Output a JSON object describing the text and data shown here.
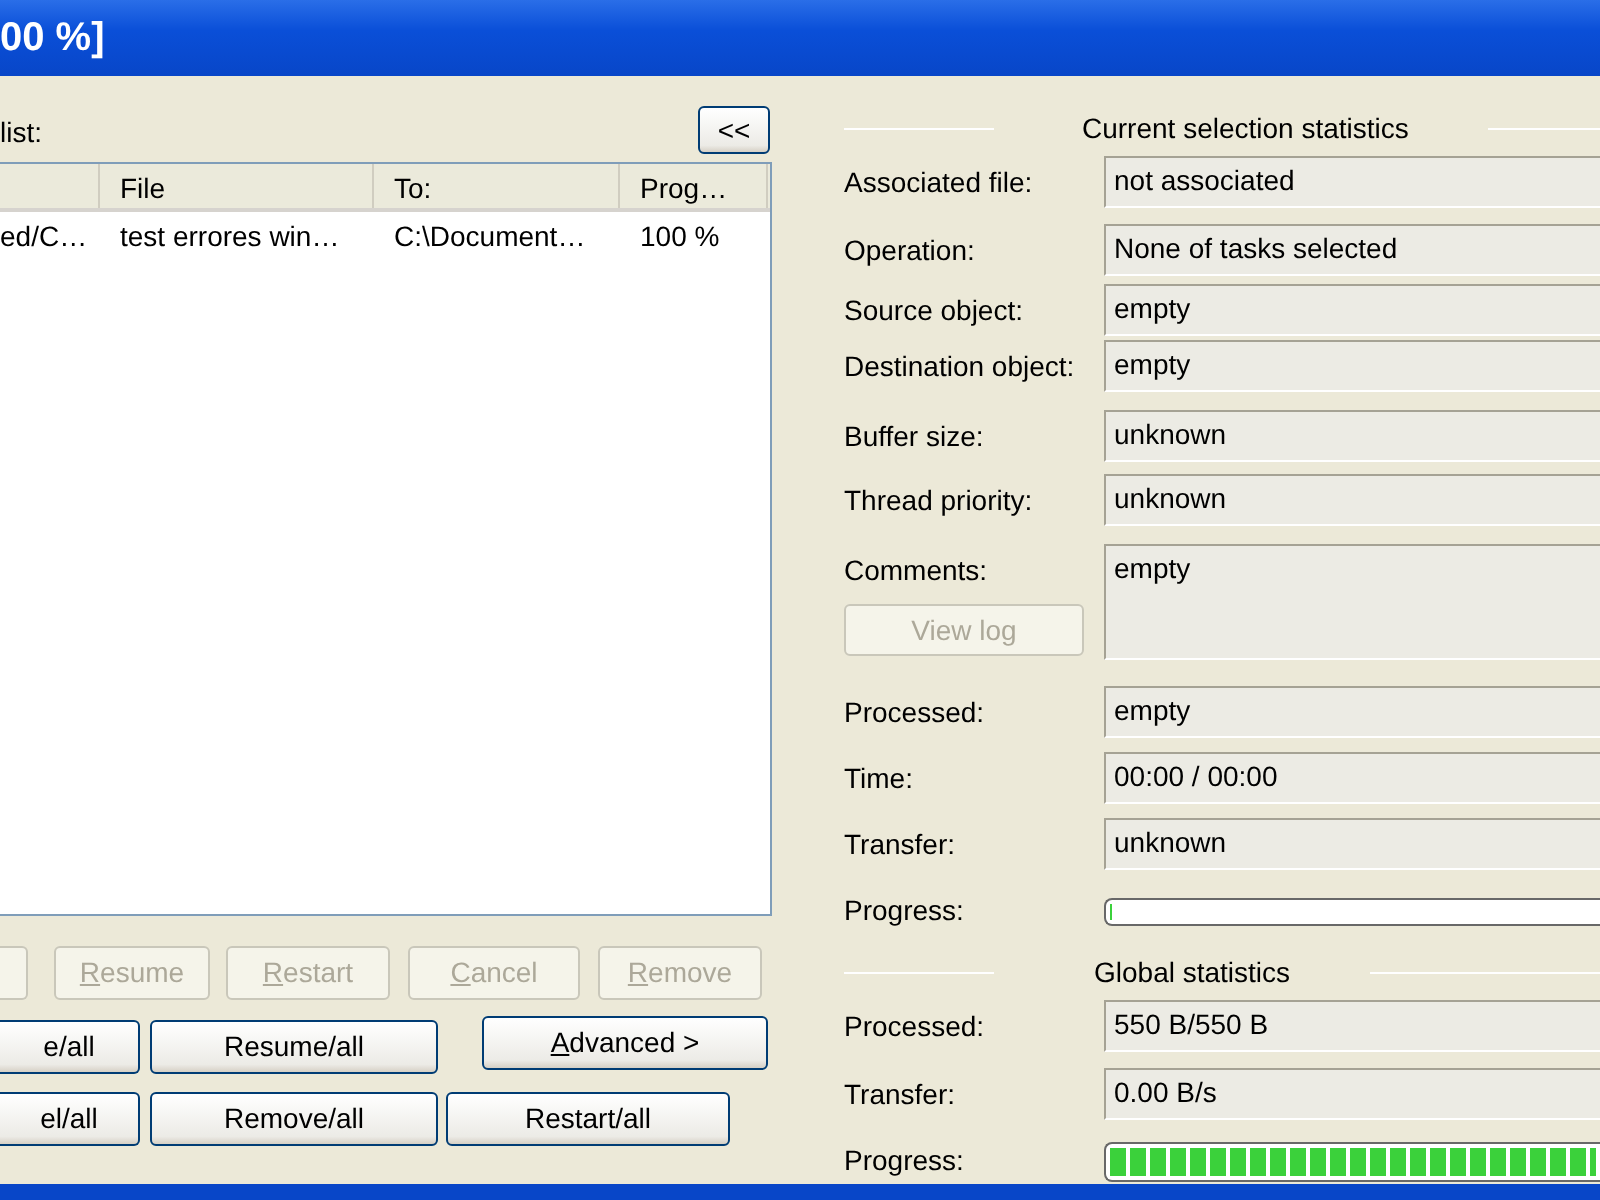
{
  "window": {
    "title": "00 %]"
  },
  "task_list": {
    "label": "list:",
    "collapse_button": "<<",
    "columns": [
      {},
      {
        "label": "File"
      },
      {
        "label": "To:"
      },
      {
        "label": "Prog…"
      }
    ],
    "rows": [
      {
        "cells": [
          "ed/C…",
          "test errores win…",
          "C:\\Document…",
          "100 %"
        ],
        "selected": false
      }
    ]
  },
  "task_buttons": [
    {
      "disabled": true
    },
    {
      "label": "Resume",
      "disabled": true,
      "underline_first": true
    },
    {
      "label": "Restart",
      "disabled": true,
      "underline_first": true
    },
    {
      "label": "Cancel",
      "disabled": true,
      "underline_first": true
    },
    {
      "label": "Remove",
      "disabled": true,
      "underline_first": true
    }
  ],
  "bulk_buttons": [
    [
      {
        "label": "e/all",
        "disabled": false
      },
      {
        "label": "Resume/all",
        "disabled": false
      },
      {
        "label": "Advanced >",
        "disabled": false,
        "underline_first": true
      }
    ],
    [
      {
        "label": "el/all",
        "disabled": false
      },
      {
        "label": "Remove/all",
        "disabled": false
      },
      {
        "label": "Restart/all",
        "disabled": false
      }
    ]
  ],
  "current_stats": {
    "title": "Current selection statistics",
    "fields": [
      {
        "kind": "text",
        "label": "Associated file:",
        "value": "not associated"
      },
      {
        "kind": "text",
        "label": "Operation:",
        "value": "None of tasks selected"
      },
      {
        "kind": "text",
        "label": "Source object:",
        "value": "empty"
      },
      {
        "kind": "text",
        "label": "Destination object:",
        "value": "empty"
      },
      {
        "kind": "text",
        "label": "Buffer size:",
        "value": "unknown"
      },
      {
        "kind": "text",
        "label": "Thread priority:",
        "value": "unknown"
      },
      {
        "kind": "multiline",
        "label": "Comments:",
        "value": "empty",
        "button": {
          "label": "View log",
          "disabled": true
        }
      },
      {
        "kind": "text",
        "label": "Processed:",
        "value": "empty"
      },
      {
        "kind": "text",
        "label": "Time:",
        "value": "00:00 / 00:00"
      },
      {
        "kind": "text",
        "label": "Transfer:",
        "value": "unknown"
      },
      {
        "kind": "progress",
        "label": "Progress:",
        "level": 0
      }
    ]
  },
  "global_stats": {
    "title": "Global statistics",
    "fields": [
      {
        "kind": "text",
        "label": "Processed:",
        "value": "550 B/550 B"
      },
      {
        "kind": "text",
        "label": "Transfer:",
        "value": "0.00 B/s"
      },
      {
        "kind": "progress",
        "label": "Progress:",
        "level": 1
      }
    ]
  }
}
